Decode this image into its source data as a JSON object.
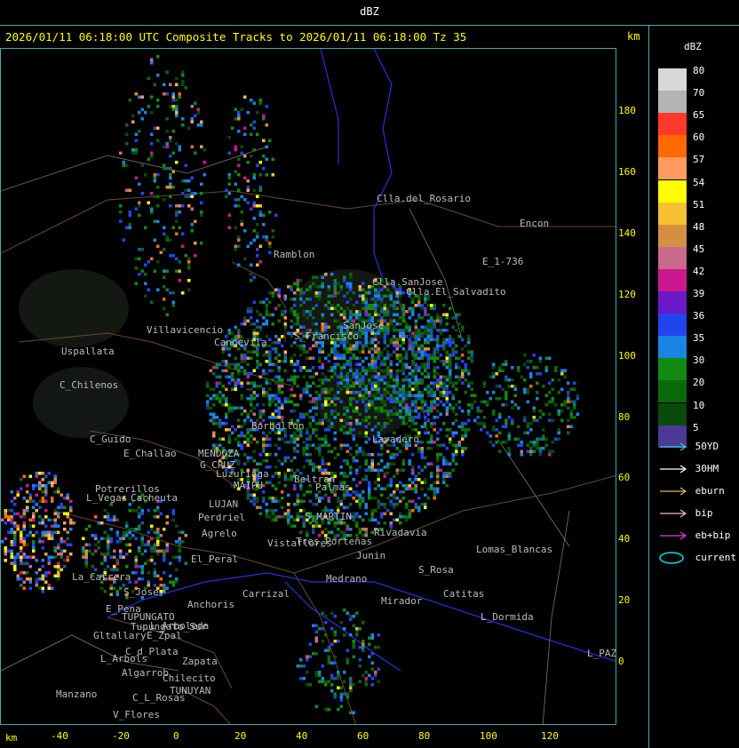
{
  "window": {
    "title": "dBZ"
  },
  "header": {
    "text": "2026/01/11 06:18:00 UTC Composite Tracks to 2026/01/11 06:18:00 Tz 35",
    "km_label": "km"
  },
  "legend": {
    "title": "dBZ",
    "bins": [
      {
        "label": "80",
        "color": "#d8d8d8"
      },
      {
        "label": "70",
        "color": "#b4b4b4"
      },
      {
        "label": "65",
        "color": "#ff3a2a"
      },
      {
        "label": "60",
        "color": "#ff6a00"
      },
      {
        "label": "57",
        "color": "#ff9a60"
      },
      {
        "label": "54",
        "color": "#ffff00"
      },
      {
        "label": "51",
        "color": "#f6c234"
      },
      {
        "label": "48",
        "color": "#d49040"
      },
      {
        "label": "45",
        "color": "#c86a8a"
      },
      {
        "label": "42",
        "color": "#cc1890"
      },
      {
        "label": "39",
        "color": "#6a18c8"
      },
      {
        "label": "36",
        "color": "#2244ee"
      },
      {
        "label": "35",
        "color": "#1a84e4"
      },
      {
        "label": "30",
        "color": "#128a12"
      },
      {
        "label": "20",
        "color": "#0a6a0a"
      },
      {
        "label": "10",
        "color": "#0a4a0a"
      },
      {
        "label": "5",
        "color": "#4a3a94"
      }
    ],
    "tracks": [
      {
        "label": "50YD",
        "color": "#40c8e0"
      },
      {
        "label": "30HM",
        "color": "#ffffff"
      },
      {
        "label": "eburn",
        "color": "#e6b060"
      },
      {
        "label": "bip",
        "color": "#ffb0c8"
      },
      {
        "label": "eb+bip",
        "color": "#e040e0"
      },
      {
        "label": "current",
        "color": "#00e0f0"
      }
    ]
  },
  "axes": {
    "x_unit": "km",
    "y_unit": "km",
    "x_ticks": [
      "-40",
      "-20",
      "0",
      "20",
      "40",
      "60",
      "80",
      "100",
      "120"
    ],
    "y_ticks": [
      "180",
      "160",
      "140",
      "120",
      "100",
      "80",
      "60",
      "40",
      "20",
      "0"
    ]
  },
  "places": [
    {
      "name": "Clla.del_Rosario"
    },
    {
      "name": "Encon"
    },
    {
      "name": "E_1-736"
    },
    {
      "name": "Ramblon"
    },
    {
      "name": "Clla.SanJose"
    },
    {
      "name": "Clla.El_Salvadito"
    },
    {
      "name": "SanJose"
    },
    {
      "name": "Villavicencio"
    },
    {
      "name": "Uspallata"
    },
    {
      "name": "Canoevila"
    },
    {
      "name": "S_Francisco"
    },
    {
      "name": "C_Chilenos"
    },
    {
      "name": "Borbollon"
    },
    {
      "name": "Lavadero"
    },
    {
      "name": "C_Guido"
    },
    {
      "name": "E_Challao"
    },
    {
      "name": "MENDOZA"
    },
    {
      "name": "G_CRUZ"
    },
    {
      "name": "Luzuriaga"
    },
    {
      "name": "Potrerillos"
    },
    {
      "name": "L_Vegas"
    },
    {
      "name": "Cacheuta"
    },
    {
      "name": "MAIPU"
    },
    {
      "name": "LUJAN"
    },
    {
      "name": "Perdriel"
    },
    {
      "name": "Agrelo"
    },
    {
      "name": "Beltran"
    },
    {
      "name": "Palmas"
    },
    {
      "name": "S_MARTIN"
    },
    {
      "name": "Lomas_Blancas"
    },
    {
      "name": "La_Carrera"
    },
    {
      "name": "Carrizal"
    },
    {
      "name": "Anchoris"
    },
    {
      "name": "TUPUNGATO"
    },
    {
      "name": "L_Arboleda"
    },
    {
      "name": "Gltallary"
    },
    {
      "name": "E_Zpal"
    },
    {
      "name": "L_Arbols"
    },
    {
      "name": "Zapata"
    },
    {
      "name": "Algarrob"
    },
    {
      "name": "TUNUYAN"
    },
    {
      "name": "Manzano"
    },
    {
      "name": "V_Flores"
    },
    {
      "name": "C_L_Rosas"
    },
    {
      "name": "Mirador"
    },
    {
      "name": "Catitas"
    },
    {
      "name": "L_Dormida"
    },
    {
      "name": "L_PAZ"
    },
    {
      "name": "Rivadavia"
    },
    {
      "name": "Junin"
    },
    {
      "name": "Medrano"
    },
    {
      "name": "S_Rosa"
    },
    {
      "name": "Tres_Porteñas"
    },
    {
      "name": "Vistaflores"
    },
    {
      "name": "Tupungato_Sur"
    },
    {
      "name": "El_Peral"
    },
    {
      "name": "S_Jose"
    },
    {
      "name": "E_Pena"
    },
    {
      "name": "C_d_Plata"
    },
    {
      "name": "Chilecito"
    }
  ]
}
